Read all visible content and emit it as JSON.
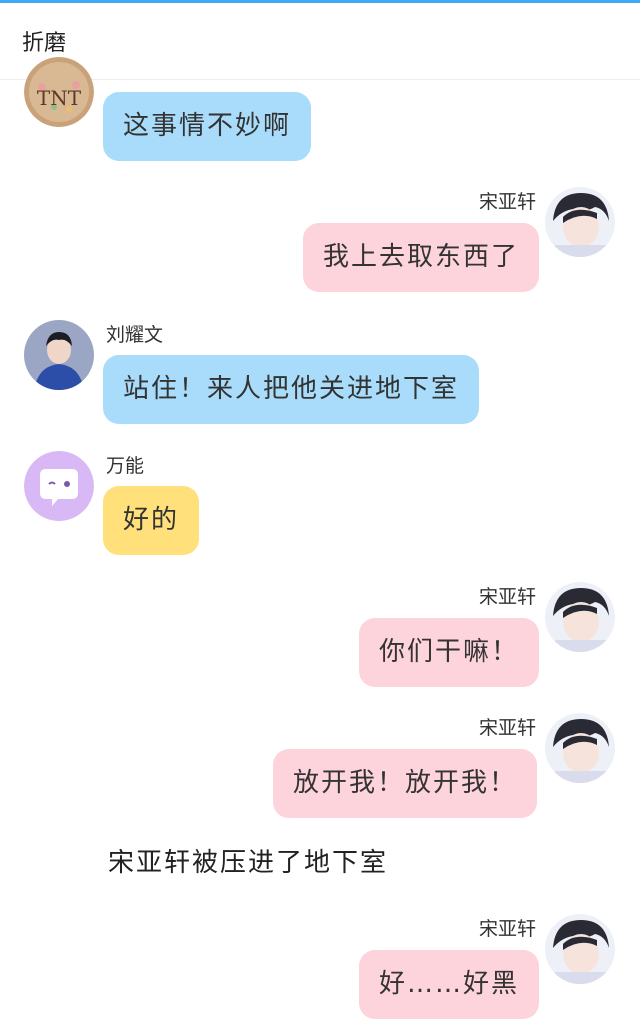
{
  "header": {
    "title": "折磨"
  },
  "messages": [
    {
      "side": "left",
      "text": "这事情不妙啊",
      "color": "blue",
      "avatar_text": "TNT"
    },
    {
      "side": "right",
      "name": "宋亚轩",
      "text": "我上去取东西了",
      "color": "pink"
    },
    {
      "side": "left",
      "name": "刘耀文",
      "text": "站住！来人把他关进地下室",
      "color": "blue"
    },
    {
      "side": "left",
      "name": "万能",
      "text": "好的",
      "color": "yellow"
    },
    {
      "side": "right",
      "name": "宋亚轩",
      "text": "你们干嘛！",
      "color": "pink"
    },
    {
      "side": "right",
      "name": "宋亚轩",
      "text": "放开我！放开我！",
      "color": "pink"
    },
    {
      "narration": "宋亚轩被压进了地下室"
    },
    {
      "side": "right",
      "name": "宋亚轩",
      "text": "好……好黑",
      "color": "pink"
    }
  ],
  "colors": {
    "accent": "#3fa9f5",
    "blue_bubble": "#a8dcfa",
    "pink_bubble": "#fdd3dc",
    "yellow_bubble": "#ffe07a",
    "purple_avatar": "#d8b8f5"
  }
}
